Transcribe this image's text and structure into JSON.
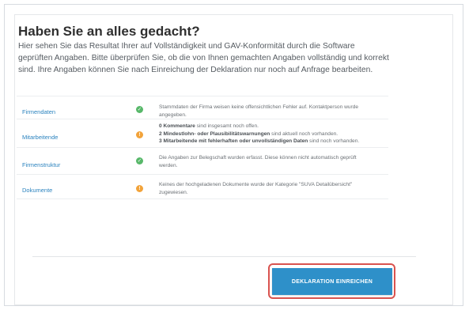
{
  "heading": "Haben Sie an alles gedacht?",
  "intro": "Hier sehen Sie das Resultat Ihrer auf Vollständigkeit und GAV-Konformität durch die Software geprüften Angaben. Bitte überprüfen Sie, ob die von Ihnen gemachten Angaben vollständig und korrekt sind. Ihre Angaben können Sie nach Einreichung der Deklaration nur noch auf Anfrage bearbeiten.",
  "rows": [
    {
      "label": "Firmendaten",
      "status_icon": "check-icon",
      "lines": [
        "Stammdaten der Firma weisen keine offensichtlichen Fehler auf. Kontaktperson wurde",
        "angegeben."
      ]
    },
    {
      "label": "Mitarbeitende",
      "status_icon": "warning-icon",
      "items": [
        {
          "strong": "0 Kommentare",
          "rest": " sind insgesamt noch offen."
        },
        {
          "strong": "2 Mindestlohn- oder Plausibilitätswarnungen",
          "rest": " sind aktuell noch vorhanden."
        },
        {
          "strong": "3 Mitarbeitende mit fehlerhaften oder unvollständigen Daten",
          "rest": " sind noch vorhanden."
        }
      ]
    },
    {
      "label": "Firmenstruktur",
      "status_icon": "check-icon",
      "lines": [
        "Die Angaben zur Belegschaft wurden erfasst. Diese können nicht automatisch geprüft",
        "werden."
      ]
    },
    {
      "label": "Dokumente",
      "status_icon": "warning-icon",
      "lines": [
        "Keines der hochgeladenen Dokumente wurde der Kategorie \"SUVA Detailübersicht\"",
        "zugewiesen."
      ]
    }
  ],
  "submit_label": "DEKLARATION EINREICHEN",
  "colors": {
    "accent": "#2e90c9",
    "link": "#2b83bf",
    "ok": "#58b86a",
    "warning": "#f2a33a",
    "highlight": "#d9534f"
  }
}
